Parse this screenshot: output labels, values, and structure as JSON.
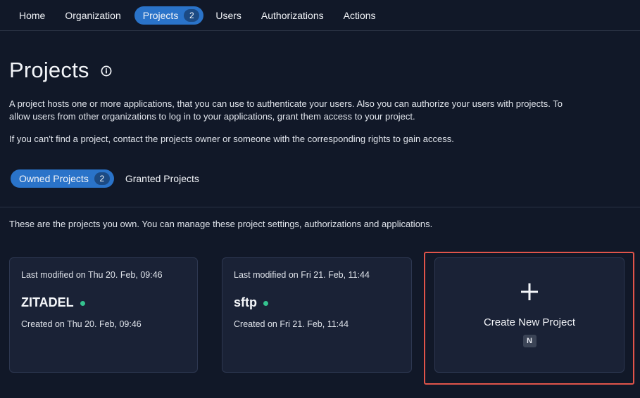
{
  "nav": {
    "home": "Home",
    "organization": "Organization",
    "projects": "Projects",
    "projects_count": "2",
    "users": "Users",
    "authorizations": "Authorizations",
    "actions": "Actions"
  },
  "page": {
    "title": "Projects",
    "description": "A project hosts one or more applications, that you can use to authenticate your users. Also you can authorize your users with projects. To allow users from other organizations to log in to your applications, grant them access to your project.",
    "description2": "If you can't find a project, contact the projects owner or someone with the corresponding rights to gain access."
  },
  "tabs": {
    "owned": "Owned Projects",
    "owned_count": "2",
    "granted": "Granted Projects"
  },
  "owned_description": "These are the projects you own. You can manage these project settings, authorizations and applications.",
  "projects": [
    {
      "modified": "Last modified on Thu 20. Feb, 09:46",
      "name": "ZITADEL",
      "created": "Created on Thu 20. Feb, 09:46",
      "status_color": "#34c38f"
    },
    {
      "modified": "Last modified on Fri 21. Feb, 11:44",
      "name": "sftp",
      "created": "Created on Fri 21. Feb, 11:44",
      "status_color": "#34c38f"
    }
  ],
  "create_card": {
    "label": "Create New Project",
    "shortcut": "N",
    "icon": "plus-icon"
  },
  "colors": {
    "background": "#111828",
    "accent": "#2a73c9",
    "card": "#1a2236",
    "highlight": "#e0544a"
  }
}
